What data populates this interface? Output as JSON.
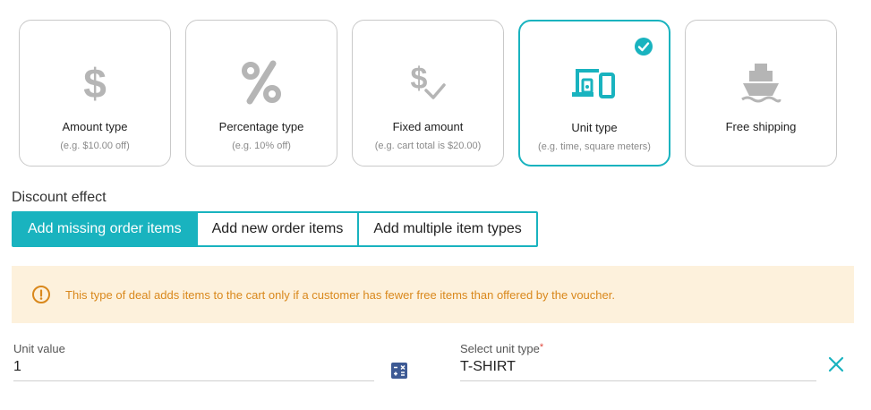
{
  "cards": [
    {
      "title": "Amount type",
      "subtitle": "(e.g. $10.00 off)",
      "icon": "dollar-icon",
      "selected": false
    },
    {
      "title": "Percentage type",
      "subtitle": "(e.g. 10% off)",
      "icon": "percent-icon",
      "selected": false
    },
    {
      "title": "Fixed amount",
      "subtitle": "(e.g. cart total is $20.00)",
      "icon": "dollar-check-icon",
      "selected": false
    },
    {
      "title": "Unit type",
      "subtitle": "(e.g. time, square meters)",
      "icon": "devices-icon",
      "selected": true
    },
    {
      "title": "Free shipping",
      "subtitle": "",
      "icon": "ship-icon",
      "selected": false
    }
  ],
  "discount_effect": {
    "label": "Discount effect",
    "options": [
      "Add missing order items",
      "Add new order items",
      "Add multiple item types"
    ],
    "active_index": 0
  },
  "notice": {
    "text": "This type of deal adds items to the cart only if a customer has fewer free items than offered by the voucher."
  },
  "unit_value": {
    "label": "Unit value",
    "value": "1"
  },
  "unit_type": {
    "label": "Select unit type",
    "required_mark": "*",
    "value": "T-SHIRT"
  },
  "colors": {
    "accent": "#19b3bf",
    "icon_gray": "#b5b5b5",
    "notice_bg": "#fdf1dc",
    "notice_text": "#d9881c"
  }
}
